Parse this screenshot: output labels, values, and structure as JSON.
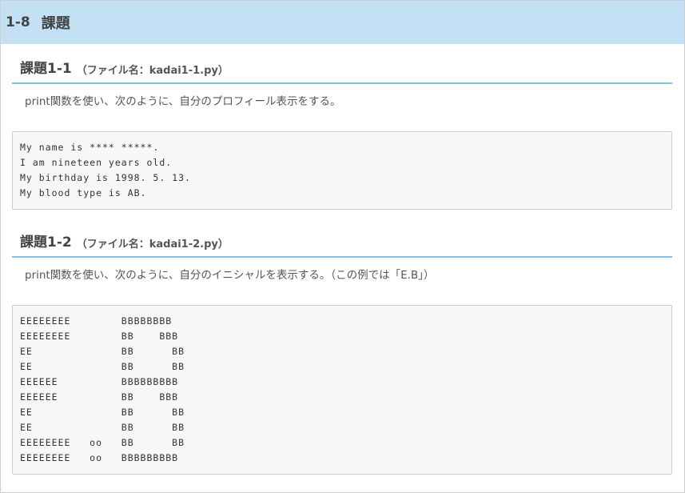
{
  "section": {
    "number": "1-8",
    "title": "課題"
  },
  "tasks": [
    {
      "title": "課題1-1",
      "file": "（ファイル名：kadai1-1.py）",
      "description": "print関数を使い、次のように、自分のプロフィール表示をする。",
      "output": "My name is **** *****.\nI am nineteen years old.\nMy birthday is 1998. 5. 13.\nMy blood type is AB."
    },
    {
      "title": "課題1-2",
      "file": "（ファイル名：kadai1-2.py）",
      "description": "print関数を使い、次のように、自分のイニシャルを表示する。（この例では「E.B」）",
      "output": "EEEEEEEE        BBBBBBBB\nEEEEEEEE        BB    BBB\nEE              BB      BB\nEE              BB      BB\nEEEEEE          BBBBBBBBB\nEEEEEE          BB    BBB\nEE              BB      BB\nEE              BB      BB\nEEEEEEEE   oo   BB      BB\nEEEEEEEE   oo   BBBBBBBBB"
    }
  ]
}
